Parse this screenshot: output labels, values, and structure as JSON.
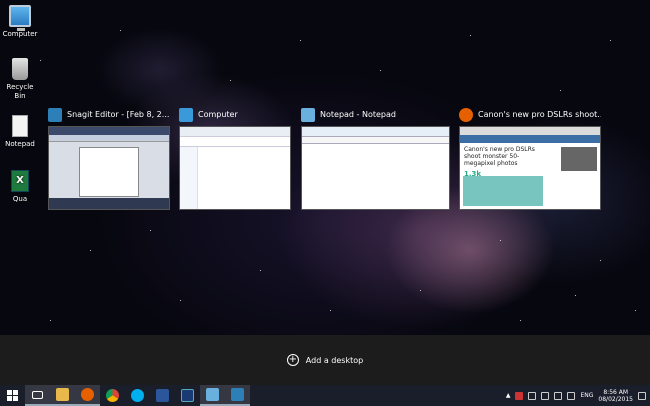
{
  "desktop_icons": [
    {
      "label": "Computer",
      "icon": "computer-icon"
    },
    {
      "label": "Recycle Bin",
      "icon": "recycle-bin-icon"
    },
    {
      "label": "Notepad",
      "icon": "notepad-file-icon"
    },
    {
      "label": "Qua",
      "icon": "excel-file-icon"
    }
  ],
  "task_view": {
    "windows": [
      {
        "title": "Snagit Editor - [Feb 8, 2...",
        "icon": "snagit-icon"
      },
      {
        "title": "Computer",
        "icon": "explorer-icon"
      },
      {
        "title": "Notepad - Notepad",
        "icon": "notepad-icon"
      },
      {
        "title": "Canon's new pro DSLRs shoot...",
        "icon": "firefox-icon",
        "close": "×",
        "thumb_headline": "Canon's new pro DSLRs shoot monster 50-megapixel photos",
        "thumb_count": "1.3k"
      }
    ],
    "add_desktop_label": "Add a desktop"
  },
  "taskbar": {
    "pinned": [
      "start-icon",
      "task-view-icon",
      "file-explorer-icon",
      "firefox-icon",
      "chrome-icon",
      "skype-icon",
      "word-icon",
      "photoshop-icon",
      "notepad-icon",
      "snagit-icon"
    ],
    "language": "ENG",
    "time": "8:56 AM",
    "date": "08/02/2015"
  },
  "colors": {
    "taskbar_bg": "#1a1d2a",
    "add_strip_bg": "#1e1e1e",
    "accent_firefox": "#e66000",
    "accent_word": "#2b579a",
    "accent_photoshop": "#1a3a73",
    "accent_skype": "#00aff0"
  }
}
